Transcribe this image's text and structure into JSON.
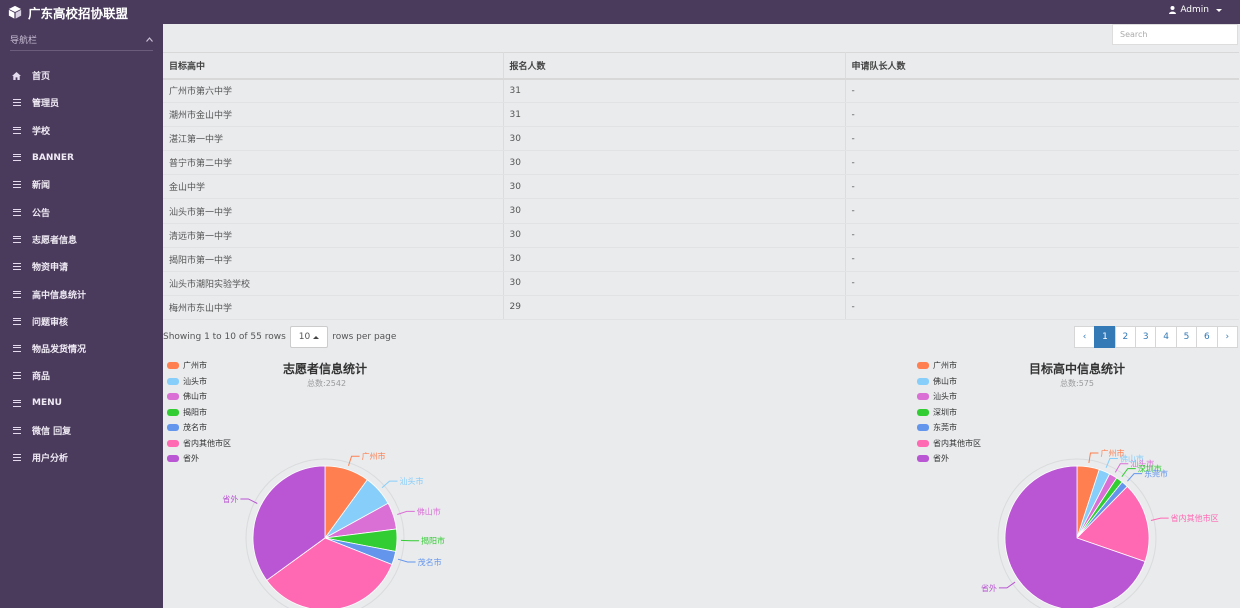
{
  "brand": {
    "title": "广东高校招协联盟"
  },
  "user": {
    "name": "Admin"
  },
  "sidebar": {
    "header": "导航栏",
    "items": [
      {
        "label": "首页",
        "icon": "home-icon"
      },
      {
        "label": "管理员",
        "icon": "list-icon"
      },
      {
        "label": "学校",
        "icon": "list-icon"
      },
      {
        "label": "BANNER",
        "icon": "list-icon"
      },
      {
        "label": "新闻",
        "icon": "list-icon"
      },
      {
        "label": "公告",
        "icon": "list-icon"
      },
      {
        "label": "志愿者信息",
        "icon": "list-icon"
      },
      {
        "label": "物资申请",
        "icon": "list-icon"
      },
      {
        "label": "高中信息统计",
        "icon": "list-icon"
      },
      {
        "label": "问题审核",
        "icon": "list-icon"
      },
      {
        "label": "物品发货情况",
        "icon": "list-icon"
      },
      {
        "label": "商品",
        "icon": "list-icon"
      },
      {
        "label": "MENU",
        "icon": "list-icon"
      },
      {
        "label": "微信 回复",
        "icon": "list-icon"
      },
      {
        "label": "用户分析",
        "icon": "list-icon"
      }
    ]
  },
  "search": {
    "placeholder": "Search"
  },
  "table": {
    "headers": [
      "目标高中",
      "报名人数",
      "申请队长人数"
    ],
    "rows": [
      [
        "广州市第六中学",
        "31",
        "-"
      ],
      [
        "潮州市金山中学",
        "31",
        "-"
      ],
      [
        "湛江第一中学",
        "30",
        "-"
      ],
      [
        "普宁市第二中学",
        "30",
        "-"
      ],
      [
        "金山中学",
        "30",
        "-"
      ],
      [
        "汕头市第一中学",
        "30",
        "-"
      ],
      [
        "清远市第一中学",
        "30",
        "-"
      ],
      [
        "揭阳市第一中学",
        "30",
        "-"
      ],
      [
        "汕头市潮阳实验学校",
        "30",
        "-"
      ],
      [
        "梅州市东山中学",
        "29",
        "-"
      ]
    ]
  },
  "pagination": {
    "showing": "Showing 1 to 10 of 55 rows",
    "page_size": "10",
    "rows_per_page": "rows per page",
    "prev": "‹",
    "next": "›",
    "pages": [
      "1",
      "2",
      "3",
      "4",
      "5",
      "6"
    ],
    "current": "1"
  },
  "chart_data": [
    {
      "type": "pie",
      "title": "志愿者信息统计",
      "subtitle": "总数:2542",
      "legend_position": "top-left",
      "labels": [
        "广州市",
        "汕头市",
        "佛山市",
        "揭阳市",
        "茂名市",
        "省内其他市区",
        "省外"
      ],
      "values": [
        10,
        7,
        6,
        5,
        3,
        34,
        35
      ],
      "colors": [
        "#ff7f50",
        "#87cefa",
        "#da70d6",
        "#32cd32",
        "#6495ed",
        "#ff69b4",
        "#ba55d3"
      ]
    },
    {
      "type": "pie",
      "title": "目标高中信息统计",
      "subtitle": "总数:575",
      "legend_position": "top-left",
      "labels": [
        "广州市",
        "佛山市",
        "汕头市",
        "深圳市",
        "东莞市",
        "省内其他市区",
        "省外"
      ],
      "values": [
        5,
        2.5,
        1.8,
        1.5,
        1.5,
        18,
        69.7
      ],
      "colors": [
        "#ff7f50",
        "#87cefa",
        "#da70d6",
        "#32cd32",
        "#6495ed",
        "#ff69b4",
        "#ba55d3"
      ]
    }
  ]
}
